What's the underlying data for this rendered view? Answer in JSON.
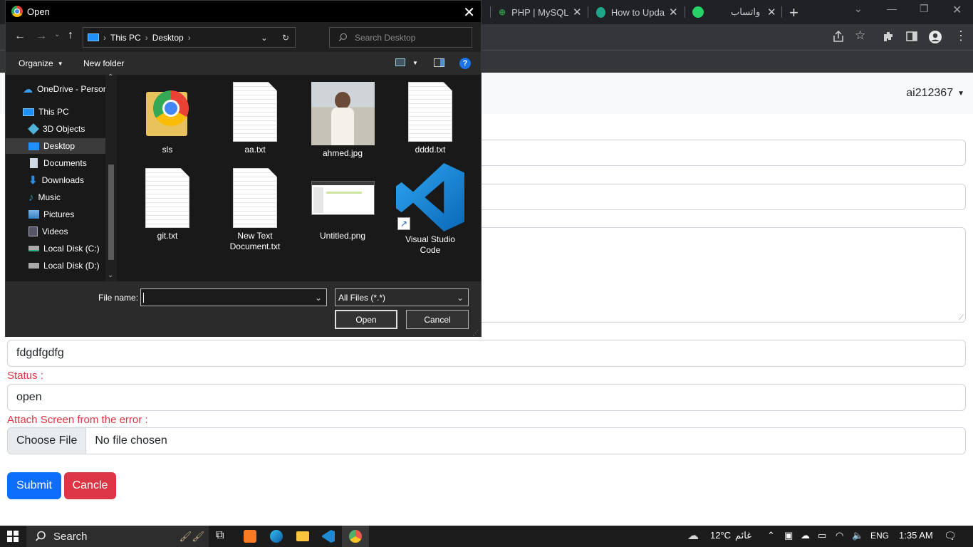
{
  "browser": {
    "tabs": [
      {
        "label": "PHP | MySQL"
      },
      {
        "label": "How to Upda"
      },
      {
        "label": "واتساب"
      }
    ]
  },
  "page": {
    "username": "ai212367",
    "fields": {
      "description_value": "fdgdfgdfg",
      "status_label": "Status :",
      "status_value": "open",
      "attach_label": "Attach Screen from the error :",
      "choose_file": "Choose File",
      "no_file": "No file chosen"
    },
    "submit": "Submit",
    "cancel": "Cancle"
  },
  "dialog": {
    "title": "Open",
    "path": [
      "This PC",
      "Desktop"
    ],
    "search_placeholder": "Search Desktop",
    "organize": "Organize",
    "new_folder": "New folder",
    "nav": [
      "OneDrive - Persor",
      "This PC",
      "3D Objects",
      "Desktop",
      "Documents",
      "Downloads",
      "Music",
      "Pictures",
      "Videos",
      "Local Disk (C:)",
      "Local Disk (D:)"
    ],
    "files": [
      {
        "name": "sls"
      },
      {
        "name": "aa.txt"
      },
      {
        "name": "ahmed.jpg"
      },
      {
        "name": "dddd.txt"
      },
      {
        "name": "git.txt"
      },
      {
        "name": "New Text Document.txt"
      },
      {
        "name": "Untitled.png"
      },
      {
        "name": "Visual Studio Code"
      }
    ],
    "filename_label": "File name:",
    "filename_value": "",
    "filetype": "All Files (*.*)",
    "open": "Open",
    "cancel": "Cancel"
  },
  "taskbar": {
    "search": "Search",
    "weather": "12°C",
    "weather_text": "غائم",
    "lang": "ENG",
    "time": "1:35 AM"
  },
  "colors": {
    "primary": "#0d6efd",
    "danger": "#dc3545",
    "dialog_bg": "#202020",
    "chrome_dark": "#202124"
  }
}
